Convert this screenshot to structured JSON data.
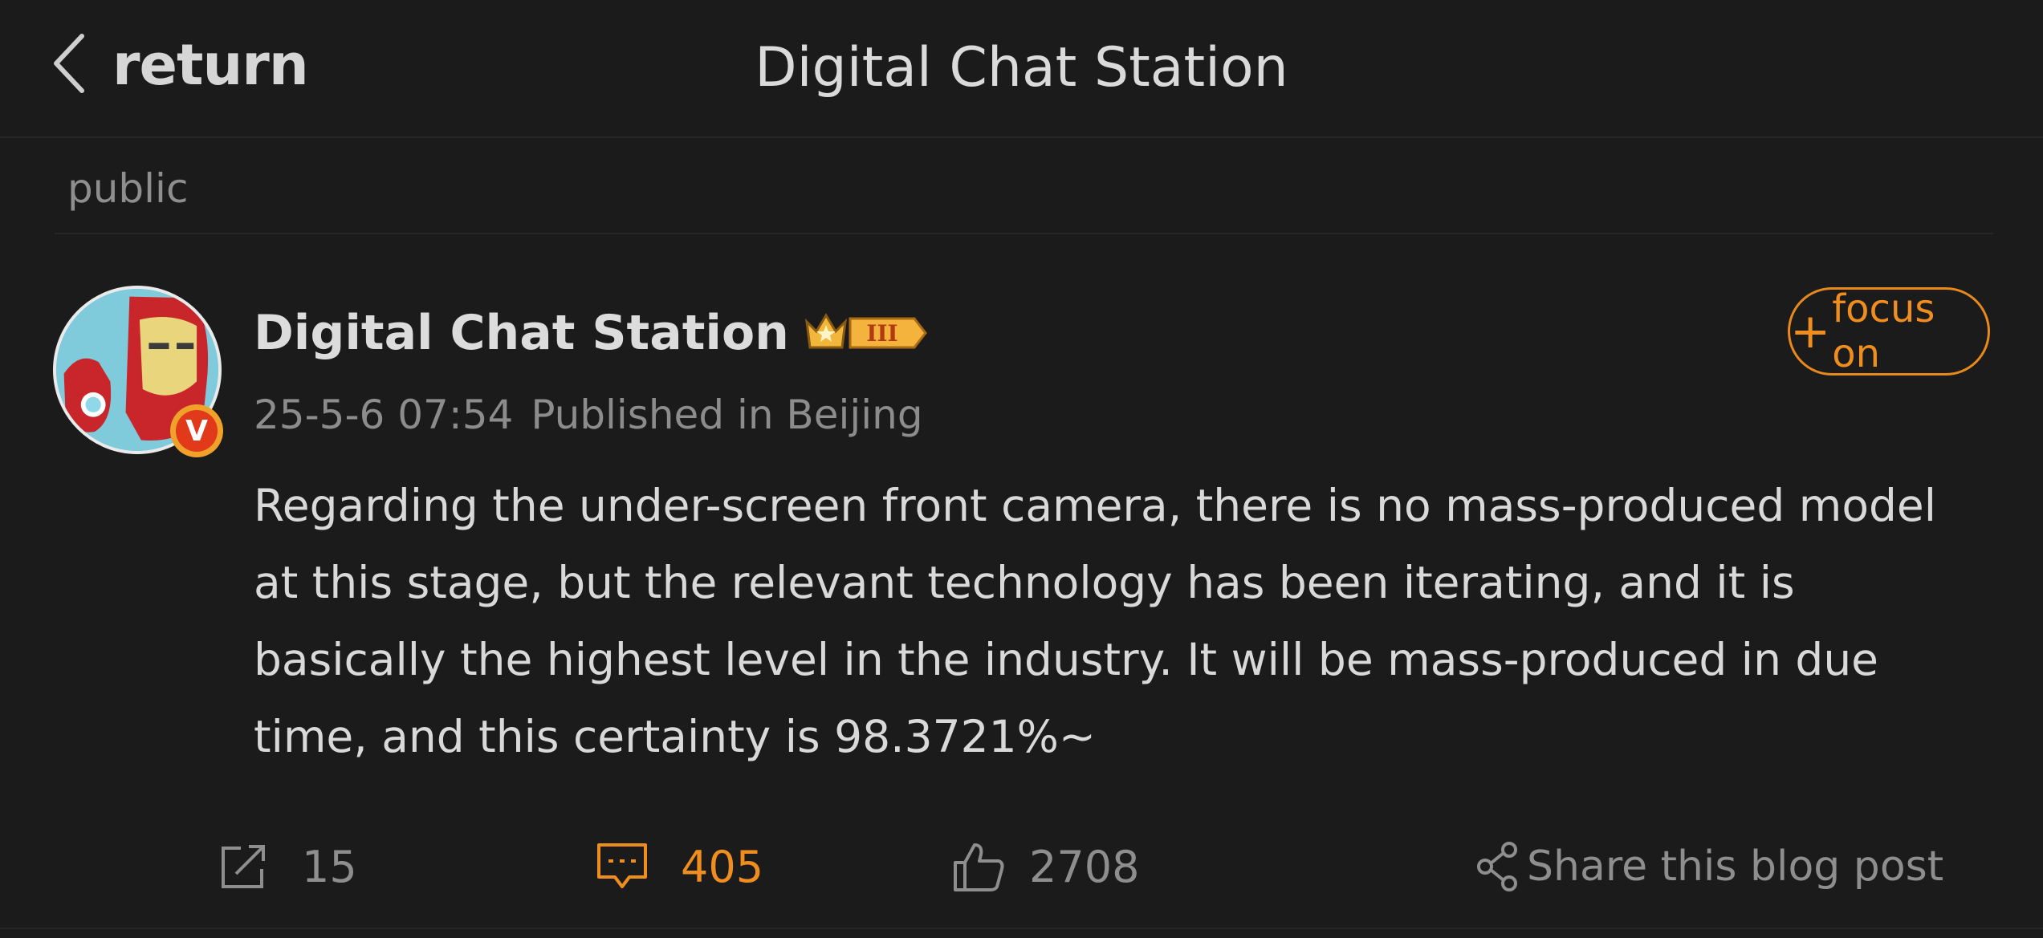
{
  "header": {
    "back_label": "return",
    "title": "Digital Chat Station"
  },
  "section": {
    "label": "public"
  },
  "post": {
    "author_name": "Digital Chat Station",
    "verified_badge": "V",
    "level_badge": "III",
    "date": "25-5-6 07:54",
    "location": "Published in Beijing",
    "follow_label": "focus on",
    "content": "Regarding the under-screen front camera, there is no mass-produced model at this stage, but the relevant technology has been iterating, and it is basically the highest level in the industry. It will be mass-produced in due time, and this certainty is 98.3721%~"
  },
  "actions": {
    "forward_count": "15",
    "comment_count": "405",
    "like_count": "2708",
    "share_label": "Share this blog post"
  },
  "colors": {
    "background": "#1b1b1b",
    "accent": "#ef8d1f",
    "text": "#d8d8d8",
    "muted": "#8c8c8c"
  },
  "icons": {
    "back": "chevron-left-icon",
    "forward": "forward-icon",
    "comment": "comment-icon",
    "like": "thumbs-up-icon",
    "share": "share-icon",
    "crown": "crown-level-icon"
  }
}
